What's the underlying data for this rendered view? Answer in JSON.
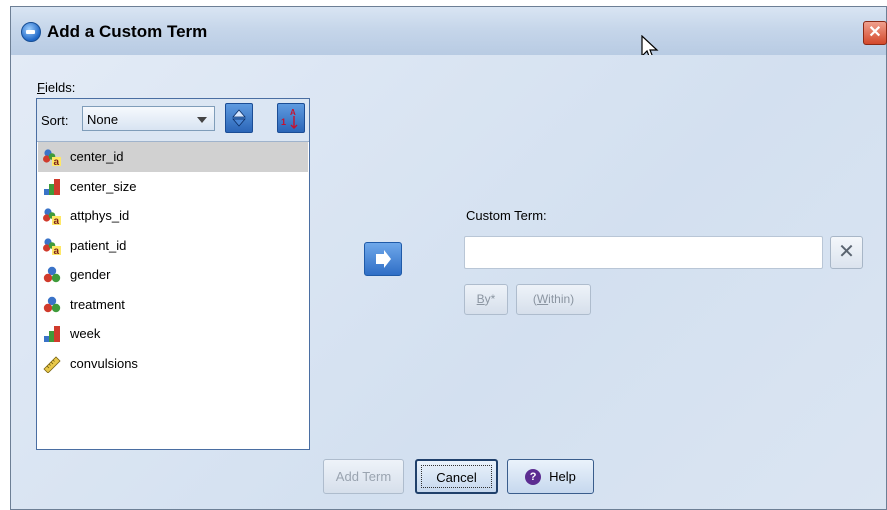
{
  "window": {
    "title": "Add a Custom Term",
    "close_glyph": "✕"
  },
  "fields": {
    "label_prefix": "",
    "label_underlined": "F",
    "label_rest": "ields:",
    "sort_label": "Sort:",
    "sort_value": "None",
    "items": [
      {
        "label": "center_id",
        "icon": "nominal-string-icon",
        "selected": true
      },
      {
        "label": "center_size",
        "icon": "ordinal-icon",
        "selected": false
      },
      {
        "label": "attphys_id",
        "icon": "nominal-string-icon",
        "selected": false
      },
      {
        "label": "patient_id",
        "icon": "nominal-string-icon",
        "selected": false
      },
      {
        "label": "gender",
        "icon": "nominal-icon",
        "selected": false
      },
      {
        "label": "treatment",
        "icon": "nominal-icon",
        "selected": false
      },
      {
        "label": "week",
        "icon": "ordinal-icon",
        "selected": false
      },
      {
        "label": "convulsions",
        "icon": "scale-icon",
        "selected": false
      }
    ]
  },
  "custom_term": {
    "label": "Custom Term:",
    "value": "",
    "clear_glyph": "✕",
    "by_underlined": "B",
    "by_rest": "y*",
    "within_open": "(",
    "within_underlined": "W",
    "within_rest": "ithin)"
  },
  "buttons": {
    "add_term": "Add Term",
    "cancel": "Cancel",
    "help": "Help",
    "help_glyph": "?"
  },
  "colors": {
    "accent": "#2f6ec6",
    "title_bar": "#c6d6ea",
    "selection": "#d1d1d1"
  }
}
